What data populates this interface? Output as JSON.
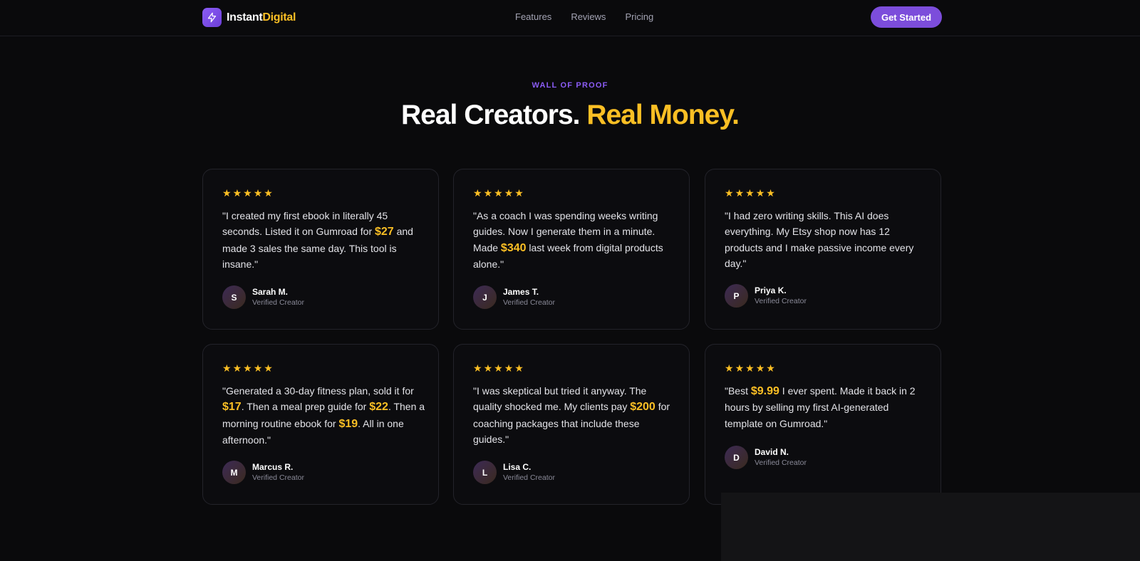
{
  "nav": {
    "brand_part1": "Instant",
    "brand_part2": "Digital",
    "links": [
      "Features",
      "Reviews",
      "Pricing"
    ],
    "cta": "Get Started"
  },
  "hero": {
    "eyebrow": "WALL OF PROOF",
    "title_part1": "Real Creators.",
    "title_part2": "Real Money."
  },
  "colors": {
    "accent_purple": "#8b5cf6",
    "accent_gold": "#fbbf24",
    "background": "#0a0a0c"
  },
  "testimonials": [
    {
      "stars": 5,
      "quote": [
        {
          "t": "\"I created my first ebook in literally 45 seconds. Listed it on Gumroad for "
        },
        {
          "t": "$27",
          "hl": true
        },
        {
          "t": " and made 3 sales the same day. This tool is insane.\""
        }
      ],
      "initial": "S",
      "name": "Sarah M.",
      "role": "Verified Creator"
    },
    {
      "stars": 5,
      "quote": [
        {
          "t": "\"As a coach I was spending weeks writing guides. Now I generate them in a minute. Made "
        },
        {
          "t": "$340",
          "hl": true
        },
        {
          "t": " last week from digital products alone.\""
        }
      ],
      "initial": "J",
      "name": "James T.",
      "role": "Verified Creator"
    },
    {
      "stars": 5,
      "quote": [
        {
          "t": "\"I had zero writing skills. This AI does everything. My Etsy shop now has 12 products and I make passive income every day.\""
        }
      ],
      "initial": "P",
      "name": "Priya K.",
      "role": "Verified Creator"
    },
    {
      "stars": 5,
      "quote": [
        {
          "t": "\"Generated a 30-day fitness plan, sold it for "
        },
        {
          "t": "$17",
          "hl": true
        },
        {
          "t": ". Then a meal prep guide for "
        },
        {
          "t": "$22",
          "hl": true
        },
        {
          "t": ". Then a morning routine ebook for "
        },
        {
          "t": "$19",
          "hl": true
        },
        {
          "t": ". All in one afternoon.\""
        }
      ],
      "initial": "M",
      "name": "Marcus R.",
      "role": "Verified Creator"
    },
    {
      "stars": 5,
      "quote": [
        {
          "t": "\"I was skeptical but tried it anyway. The quality shocked me. My clients pay "
        },
        {
          "t": "$200",
          "hl": true
        },
        {
          "t": " for coaching packages that include these guides.\""
        }
      ],
      "initial": "L",
      "name": "Lisa C.",
      "role": "Verified Creator"
    },
    {
      "stars": 5,
      "quote": [
        {
          "t": "\"Best "
        },
        {
          "t": "$9.99",
          "hl": true
        },
        {
          "t": " I ever spent. Made it back in 2 hours by selling my first AI-generated template on Gumroad.\""
        }
      ],
      "initial": "D",
      "name": "David N.",
      "role": "Verified Creator"
    }
  ]
}
